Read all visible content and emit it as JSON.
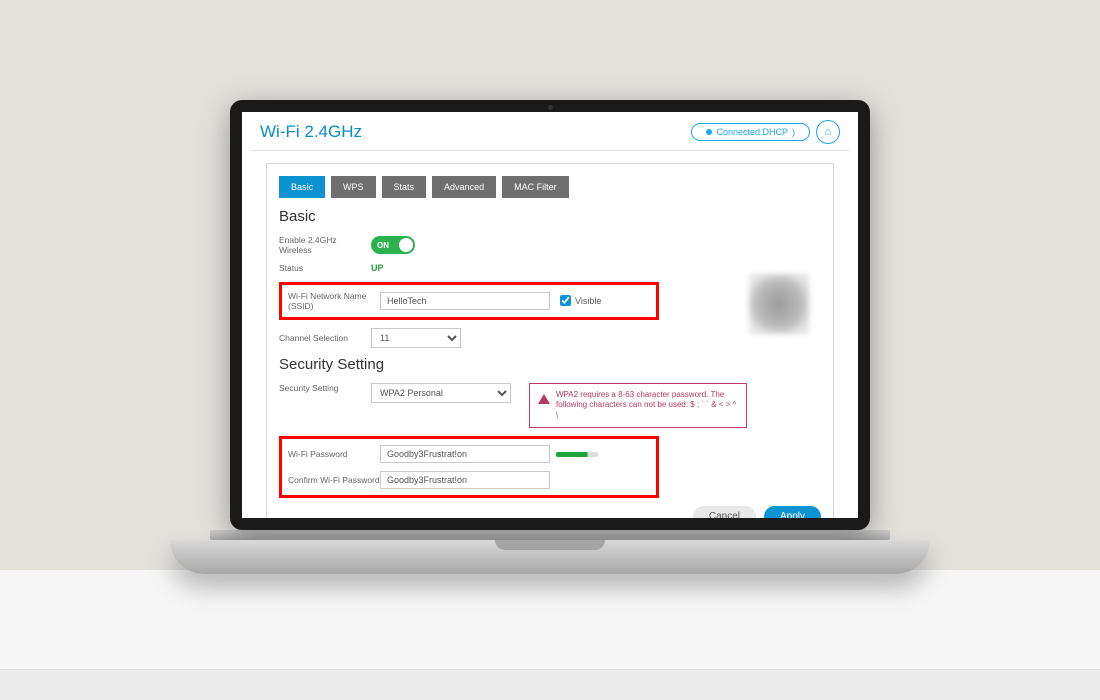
{
  "header": {
    "title": "Wi-Fi 2.4GHz",
    "connection_status": "Connected  DHCP",
    "home_icon": "⌂"
  },
  "tabs": [
    "Basic",
    "WPS",
    "Stats",
    "Advanced",
    "MAC Filter"
  ],
  "active_tab": "Basic",
  "basic": {
    "section_title": "Basic",
    "enable_label": "Enable 2.4GHz Wireless",
    "toggle_text": "ON",
    "status_label": "Status",
    "status_value": "UP",
    "ssid_label": "Wi-Fi Network Name (SSID)",
    "ssid_value": "HelloTech",
    "visible_checked": true,
    "visible_label": "Visible",
    "channel_label": "Channel Selection",
    "channel_value": "11"
  },
  "security": {
    "section_title": "Security Setting",
    "setting_label": "Security Setting",
    "setting_value": "WPA2 Personal",
    "warning_text": "WPA2 requires a 8-63 character password. The following characters can not be used: $ ; ` ´ & < > ^ \\",
    "password_label": "Wi-Fi Password",
    "password_value": "Goodby3Frustrat!on",
    "confirm_label": "Confirm Wi-Fi Password",
    "confirm_value": "Goodby3Frustrat!on"
  },
  "buttons": {
    "cancel": "Cancel",
    "apply": "Apply"
  }
}
